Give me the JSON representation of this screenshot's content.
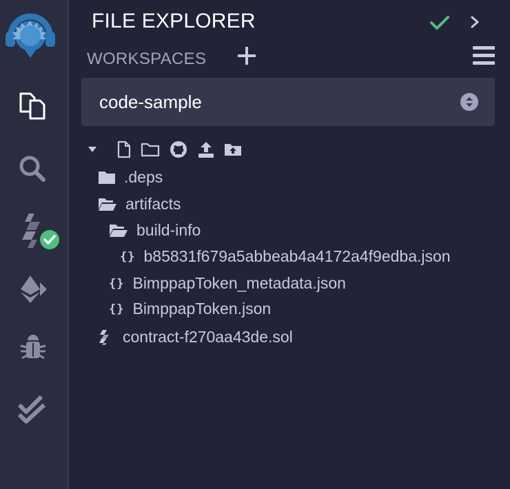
{
  "sidebar": {
    "icons": [
      {
        "name": "remix-logo-icon"
      },
      {
        "name": "file-explorer-icon"
      },
      {
        "name": "search-icon"
      },
      {
        "name": "solidity-compiler-icon"
      },
      {
        "name": "ethereum-deploy-icon"
      },
      {
        "name": "debugger-icon"
      },
      {
        "name": "testing-icon"
      }
    ]
  },
  "header": {
    "title": "FILE EXPLORER"
  },
  "workspaces": {
    "label": "WORKSPACES",
    "selected": "code-sample"
  },
  "tree": {
    "items": [
      {
        "label": ".deps",
        "type": "folder"
      },
      {
        "label": "artifacts",
        "type": "folder-open"
      },
      {
        "label": "build-info",
        "type": "folder-open"
      },
      {
        "label": "b85831f679a5abbeab4a4172a4f9edba.json",
        "type": "json"
      },
      {
        "label": "BimppapToken_metadata.json",
        "type": "json"
      },
      {
        "label": "BimppapToken.json",
        "type": "json"
      },
      {
        "label": "contract-f270aa43de.sol",
        "type": "solidity"
      }
    ],
    "json_icon": "{}"
  },
  "colors": {
    "background": "#222336",
    "sidebar": "#2a2c3f",
    "select": "#35384c",
    "accent_green": "#4fbf7f",
    "remix_blue": "#2e77b6"
  }
}
